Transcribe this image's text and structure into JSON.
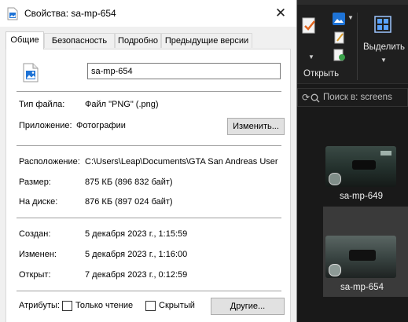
{
  "window": {
    "title": "Свойства: sa-mp-654",
    "close_symbol": "✕"
  },
  "tabs": [
    "Общие",
    "Безопасность",
    "Подробно",
    "Предыдущие версии"
  ],
  "general": {
    "file_name": "sa-mp-654",
    "file_type_label": "Тип файла:",
    "file_type_value": "Файл \"PNG\" (.png)",
    "app_label": "Приложение:",
    "app_value": "Фотографии",
    "change_button": "Изменить...",
    "location_label": "Расположение:",
    "location_value": "C:\\Users\\Leap\\Documents\\GTA San Andreas User",
    "size_label": "Размер:",
    "size_value": "875 КБ (896 832 байт)",
    "disk_label": "На диске:",
    "disk_value": "876 КБ (897 024 байт)",
    "created_label": "Создан:",
    "created_value": "5 декабря 2023 г., 1:15:59",
    "modified_label": "Изменен:",
    "modified_value": "5 декабря 2023 г., 1:16:00",
    "opened_label": "Открыт:",
    "opened_value": "7 декабря 2023 г., 0:12:59",
    "attributes_label": "Атрибуты:",
    "readonly_label": "Только чтение",
    "hidden_label": "Скрытый",
    "other_button": "Другие..."
  },
  "explorer": {
    "open_label": "Открыть",
    "select_label": "Выделить",
    "search_placeholder": "Поиск в: screens",
    "thumbnails": [
      "sa-mp-649",
      "sa-mp-654"
    ]
  },
  "colors": {
    "dialog_bg": "#f0f0f0",
    "panel_bg": "#ffffff",
    "explorer_bg": "#191919",
    "selected_tile": "#3a3a3a",
    "photo_icon_blue": "#1e73d6"
  },
  "icons": [
    "image-file-icon",
    "close-icon",
    "edit-checkmark-icon",
    "select-grid-icon",
    "refresh-icon",
    "search-icon"
  ]
}
